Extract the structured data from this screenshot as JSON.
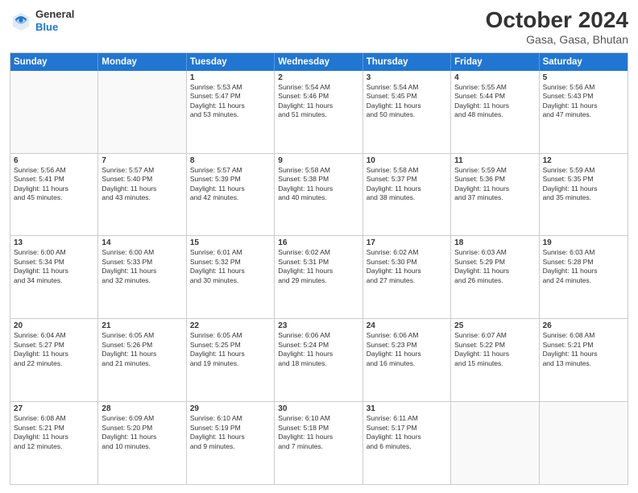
{
  "header": {
    "logo_general": "General",
    "logo_blue": "Blue",
    "month": "October 2024",
    "location": "Gasa, Gasa, Bhutan"
  },
  "days_of_week": [
    "Sunday",
    "Monday",
    "Tuesday",
    "Wednesday",
    "Thursday",
    "Friday",
    "Saturday"
  ],
  "weeks": [
    [
      {
        "day": "",
        "info": ""
      },
      {
        "day": "",
        "info": ""
      },
      {
        "day": "1",
        "info": "Sunrise: 5:53 AM\nSunset: 5:47 PM\nDaylight: 11 hours\nand 53 minutes."
      },
      {
        "day": "2",
        "info": "Sunrise: 5:54 AM\nSunset: 5:46 PM\nDaylight: 11 hours\nand 51 minutes."
      },
      {
        "day": "3",
        "info": "Sunrise: 5:54 AM\nSunset: 5:45 PM\nDaylight: 11 hours\nand 50 minutes."
      },
      {
        "day": "4",
        "info": "Sunrise: 5:55 AM\nSunset: 5:44 PM\nDaylight: 11 hours\nand 48 minutes."
      },
      {
        "day": "5",
        "info": "Sunrise: 5:56 AM\nSunset: 5:43 PM\nDaylight: 11 hours\nand 47 minutes."
      }
    ],
    [
      {
        "day": "6",
        "info": "Sunrise: 5:56 AM\nSunset: 5:41 PM\nDaylight: 11 hours\nand 45 minutes."
      },
      {
        "day": "7",
        "info": "Sunrise: 5:57 AM\nSunset: 5:40 PM\nDaylight: 11 hours\nand 43 minutes."
      },
      {
        "day": "8",
        "info": "Sunrise: 5:57 AM\nSunset: 5:39 PM\nDaylight: 11 hours\nand 42 minutes."
      },
      {
        "day": "9",
        "info": "Sunrise: 5:58 AM\nSunset: 5:38 PM\nDaylight: 11 hours\nand 40 minutes."
      },
      {
        "day": "10",
        "info": "Sunrise: 5:58 AM\nSunset: 5:37 PM\nDaylight: 11 hours\nand 38 minutes."
      },
      {
        "day": "11",
        "info": "Sunrise: 5:59 AM\nSunset: 5:36 PM\nDaylight: 11 hours\nand 37 minutes."
      },
      {
        "day": "12",
        "info": "Sunrise: 5:59 AM\nSunset: 5:35 PM\nDaylight: 11 hours\nand 35 minutes."
      }
    ],
    [
      {
        "day": "13",
        "info": "Sunrise: 6:00 AM\nSunset: 5:34 PM\nDaylight: 11 hours\nand 34 minutes."
      },
      {
        "day": "14",
        "info": "Sunrise: 6:00 AM\nSunset: 5:33 PM\nDaylight: 11 hours\nand 32 minutes."
      },
      {
        "day": "15",
        "info": "Sunrise: 6:01 AM\nSunset: 5:32 PM\nDaylight: 11 hours\nand 30 minutes."
      },
      {
        "day": "16",
        "info": "Sunrise: 6:02 AM\nSunset: 5:31 PM\nDaylight: 11 hours\nand 29 minutes."
      },
      {
        "day": "17",
        "info": "Sunrise: 6:02 AM\nSunset: 5:30 PM\nDaylight: 11 hours\nand 27 minutes."
      },
      {
        "day": "18",
        "info": "Sunrise: 6:03 AM\nSunset: 5:29 PM\nDaylight: 11 hours\nand 26 minutes."
      },
      {
        "day": "19",
        "info": "Sunrise: 6:03 AM\nSunset: 5:28 PM\nDaylight: 11 hours\nand 24 minutes."
      }
    ],
    [
      {
        "day": "20",
        "info": "Sunrise: 6:04 AM\nSunset: 5:27 PM\nDaylight: 11 hours\nand 22 minutes."
      },
      {
        "day": "21",
        "info": "Sunrise: 6:05 AM\nSunset: 5:26 PM\nDaylight: 11 hours\nand 21 minutes."
      },
      {
        "day": "22",
        "info": "Sunrise: 6:05 AM\nSunset: 5:25 PM\nDaylight: 11 hours\nand 19 minutes."
      },
      {
        "day": "23",
        "info": "Sunrise: 6:06 AM\nSunset: 5:24 PM\nDaylight: 11 hours\nand 18 minutes."
      },
      {
        "day": "24",
        "info": "Sunrise: 6:06 AM\nSunset: 5:23 PM\nDaylight: 11 hours\nand 16 minutes."
      },
      {
        "day": "25",
        "info": "Sunrise: 6:07 AM\nSunset: 5:22 PM\nDaylight: 11 hours\nand 15 minutes."
      },
      {
        "day": "26",
        "info": "Sunrise: 6:08 AM\nSunset: 5:21 PM\nDaylight: 11 hours\nand 13 minutes."
      }
    ],
    [
      {
        "day": "27",
        "info": "Sunrise: 6:08 AM\nSunset: 5:21 PM\nDaylight: 11 hours\nand 12 minutes."
      },
      {
        "day": "28",
        "info": "Sunrise: 6:09 AM\nSunset: 5:20 PM\nDaylight: 11 hours\nand 10 minutes."
      },
      {
        "day": "29",
        "info": "Sunrise: 6:10 AM\nSunset: 5:19 PM\nDaylight: 11 hours\nand 9 minutes."
      },
      {
        "day": "30",
        "info": "Sunrise: 6:10 AM\nSunset: 5:18 PM\nDaylight: 11 hours\nand 7 minutes."
      },
      {
        "day": "31",
        "info": "Sunrise: 6:11 AM\nSunset: 5:17 PM\nDaylight: 11 hours\nand 6 minutes."
      },
      {
        "day": "",
        "info": ""
      },
      {
        "day": "",
        "info": ""
      }
    ]
  ]
}
